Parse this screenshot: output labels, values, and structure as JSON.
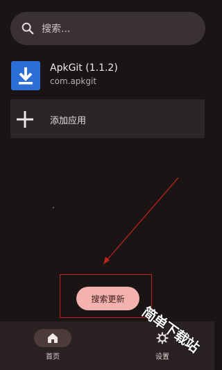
{
  "search": {
    "placeholder": "搜索...",
    "icon": "search-icon"
  },
  "apps": [
    {
      "name": "ApkGit (1.1.2)",
      "package": "com.apkgit",
      "icon": "download-icon",
      "icon_color": "#2d6ed6"
    }
  ],
  "add_app": {
    "label": "添加应用",
    "icon": "plus-icon"
  },
  "refresh_button": {
    "label": "搜索更新",
    "color": "#f3b2ad"
  },
  "annotation": {
    "color": "#c3231f"
  },
  "bottom_nav": {
    "items": [
      {
        "label": "首页",
        "icon": "home-icon",
        "selected": true
      },
      {
        "label": "设置",
        "icon": "gear-icon",
        "selected": false
      }
    ]
  },
  "watermark": {
    "text": "简单下载站"
  },
  "colors": {
    "background": "#1a1414",
    "surface": "#2c2525",
    "search_bar": "#3a3232",
    "nav_bar": "#2a2222"
  }
}
